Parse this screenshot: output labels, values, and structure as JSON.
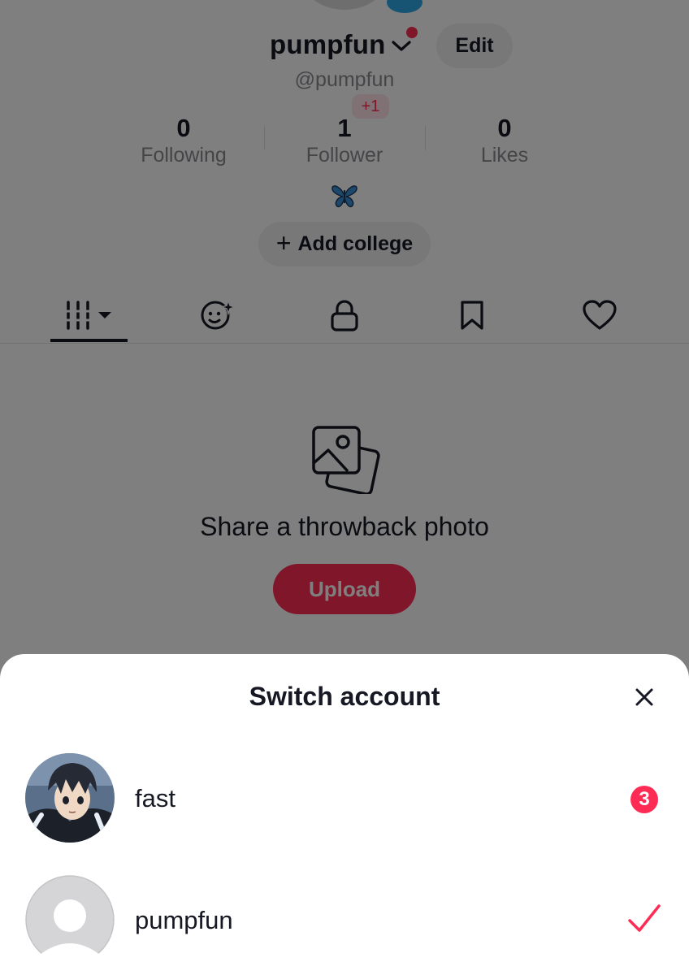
{
  "profile": {
    "username": "pumpfun",
    "handle": "@pumpfun",
    "edit_label": "Edit",
    "follower_delta": "+1",
    "stats": [
      {
        "value": "0",
        "label": "Following"
      },
      {
        "value": "1",
        "label": "Follower"
      },
      {
        "value": "0",
        "label": "Likes"
      }
    ],
    "bio_emoji_icon": "butterfly-icon",
    "add_college_plus": "+",
    "add_college_label": "Add college"
  },
  "tabs": [
    {
      "icon": "grid-videos-icon",
      "active": true
    },
    {
      "icon": "reposts-icon",
      "active": false
    },
    {
      "icon": "lock-icon",
      "active": false
    },
    {
      "icon": "bookmark-icon",
      "active": false
    },
    {
      "icon": "heart-icon",
      "active": false
    }
  ],
  "empty_state": {
    "icon": "photos-icon",
    "title": "Share a throwback photo",
    "button_label": "Upload"
  },
  "switch_sheet": {
    "title": "Switch account",
    "close_icon": "close-icon",
    "accounts": [
      {
        "name": "fast",
        "avatar": "anime-avatar",
        "notification_count": "3"
      },
      {
        "name": "pumpfun",
        "avatar": "default-avatar",
        "selected": true
      }
    ]
  },
  "colors": {
    "accent": "#fe2c55",
    "overlay": "rgba(0,0,0,0.5)",
    "text_primary": "#161823",
    "text_secondary": "#8a8b91"
  }
}
